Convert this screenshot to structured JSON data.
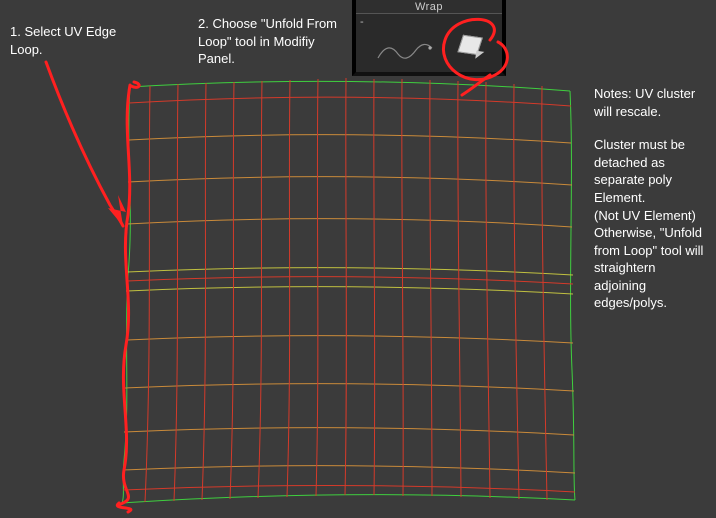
{
  "annotations": {
    "step1": "1. Select UV Edge Loop.",
    "step2": "2. Choose \"Unfold From Loop\" tool in Modifiy Panel.",
    "notes_line1": "Notes: UV cluster will rescale.",
    "notes_line2": "Cluster must be detached as separate poly Element.",
    "notes_line3": "(Not UV Element)",
    "notes_line4": "Otherwise, \"Unfold from Loop\" tool will straightern adjoining edges/polys."
  },
  "panel": {
    "title": "Wrap",
    "dash": "-"
  },
  "icons": {
    "unfold": "unfold-from-loop-icon",
    "squiggle": "wrap-squiggle-icon"
  }
}
